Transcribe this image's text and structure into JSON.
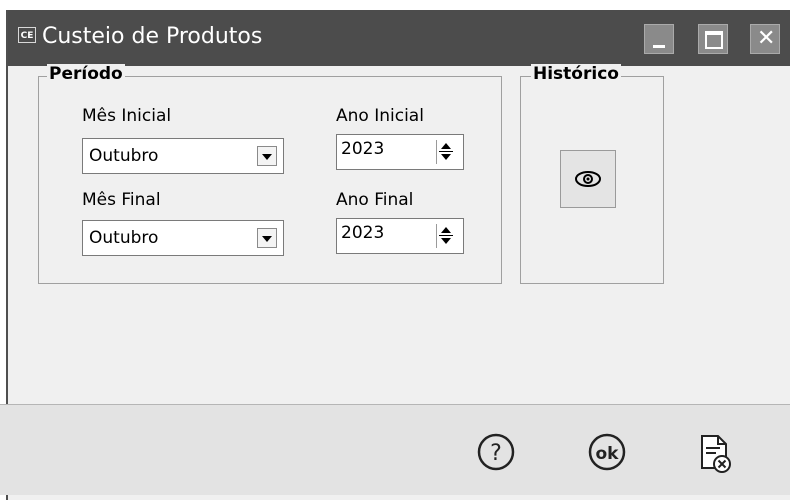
{
  "window": {
    "icon_text": "CE",
    "title": "Custeio de Produtos"
  },
  "periodo": {
    "title": "Período",
    "mes_inicial": {
      "label": "Mês Inicial",
      "value": "Outubro"
    },
    "ano_inicial": {
      "label": "Ano Inicial",
      "value": "2023"
    },
    "mes_final": {
      "label": "Mês Final",
      "value": "Outubro"
    },
    "ano_final": {
      "label": "Ano Final",
      "value": "2023"
    }
  },
  "historico": {
    "title": "Histórico",
    "view_icon": "eye-icon"
  },
  "footer": {
    "help_icon": "help-icon",
    "ok_label": "ok",
    "cancel_icon": "cancel-document-icon"
  }
}
